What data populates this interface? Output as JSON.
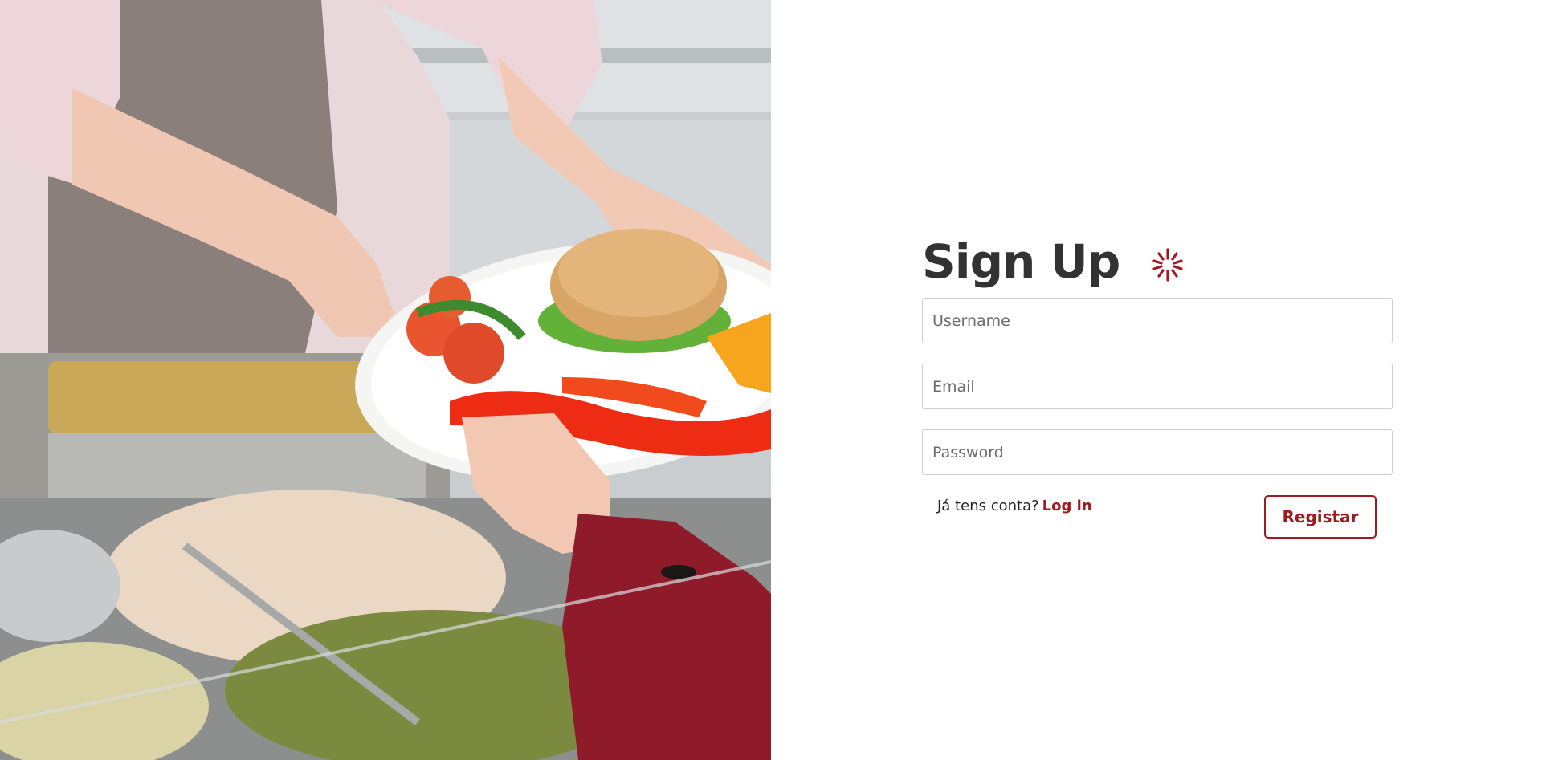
{
  "hero": {
    "alt": "Cafeteria worker handing a plate with a burger, salad, peppers and orange"
  },
  "form": {
    "title": "Sign Up",
    "logo_icon": "uminho-asterisk-icon",
    "username_placeholder": "Username",
    "email_placeholder": "Email",
    "password_placeholder": "Password",
    "login_prompt": "Já tens conta?",
    "login_link": "Log in",
    "register_button": "Registar"
  },
  "colors": {
    "accent": "#a01a1f",
    "title": "#333333",
    "field_border": "#cfcfcf"
  }
}
